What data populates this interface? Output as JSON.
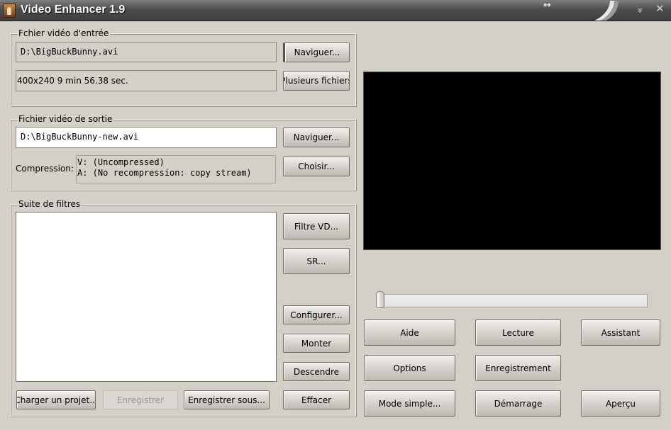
{
  "window": {
    "title": "Video Enhancer 1.9",
    "resize_glyph": "↔",
    "minimize_glyph": "»",
    "close_glyph": "✕"
  },
  "input_group": {
    "legend": "Fchier vidéo d'entrée",
    "path": "D:\\BigBuckBunny.avi",
    "info": "400x240 9 min 56.38 sec.",
    "browse_label": "Naviguer...",
    "multiple_label": "Plusieurs fichiers"
  },
  "output_group": {
    "legend": "Fichier vidéo de sortie",
    "path": "D:\\BigBuckBunny-new.avi",
    "browse_label": "Naviguer...",
    "compression_label": "Compression:",
    "compression_video": "V: (Uncompressed)",
    "compression_audio": "A: (No recompression: copy stream)",
    "choose_label": "Choisir..."
  },
  "filters_group": {
    "legend": "Suite de filtres",
    "items": [],
    "buttons": {
      "vd_filter": "Filtre VD...",
      "sr": "SR...",
      "configure": "Configurer...",
      "move_up": "Monter",
      "move_down": "Descendre",
      "clear": "Effacer"
    },
    "load_project": "Charger un projet...",
    "save": "Enregistrer",
    "save_as": "Enregistrer sous..."
  },
  "player": {
    "seek_position": 0
  },
  "actions": {
    "help": "Aide",
    "play": "Lecture",
    "wizard": "Assistant",
    "options": "Options",
    "record": "Enregistrement",
    "simple_mode": "Mode simple...",
    "start": "Démarrage",
    "preview": "Aperçu"
  },
  "icons": {
    "app": "film-reel-icon",
    "resize": "resize-arrows-icon",
    "minimize": "double-chevron-down-icon",
    "close": "close-icon"
  }
}
